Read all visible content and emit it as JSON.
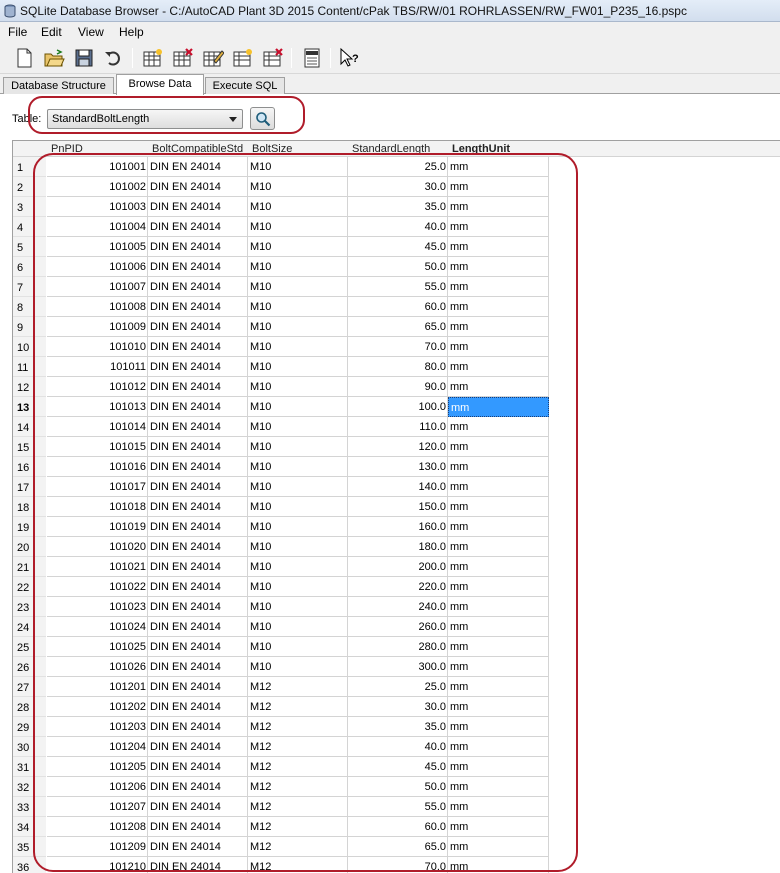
{
  "window": {
    "title": "SQLite Database Browser - C:/AutoCAD Plant 3D 2015 Content/cPak TBS/RW/01 ROHRLASSEN/RW_FW01_P235_16.pspc"
  },
  "menu": [
    "File",
    "Edit",
    "View",
    "Help"
  ],
  "toolbar": {
    "icons": [
      "new-database-icon",
      "open-database-icon",
      "save-icon",
      "undo-icon",
      "create-table-icon",
      "delete-table-icon",
      "modify-table-icon",
      "create-index-icon",
      "delete-index-icon",
      "sql-log-icon",
      "whats-this-help-icon"
    ]
  },
  "tabs": [
    "Database Structure",
    "Browse Data",
    "Execute SQL"
  ],
  "active_tab": "Browse Data",
  "browse": {
    "table_label": "Table:",
    "table_value": "StandardBoltLength"
  },
  "grid": {
    "columns": [
      "PnPID",
      "BoltCompatibleStd",
      "BoltSize",
      "StandardLength",
      "LengthUnit"
    ],
    "selected_row": 13,
    "rows": [
      [
        "1",
        "101001",
        "DIN EN 24014",
        "M10",
        "25.0",
        "mm"
      ],
      [
        "2",
        "101002",
        "DIN EN 24014",
        "M10",
        "30.0",
        "mm"
      ],
      [
        "3",
        "101003",
        "DIN EN 24014",
        "M10",
        "35.0",
        "mm"
      ],
      [
        "4",
        "101004",
        "DIN EN 24014",
        "M10",
        "40.0",
        "mm"
      ],
      [
        "5",
        "101005",
        "DIN EN 24014",
        "M10",
        "45.0",
        "mm"
      ],
      [
        "6",
        "101006",
        "DIN EN 24014",
        "M10",
        "50.0",
        "mm"
      ],
      [
        "7",
        "101007",
        "DIN EN 24014",
        "M10",
        "55.0",
        "mm"
      ],
      [
        "8",
        "101008",
        "DIN EN 24014",
        "M10",
        "60.0",
        "mm"
      ],
      [
        "9",
        "101009",
        "DIN EN 24014",
        "M10",
        "65.0",
        "mm"
      ],
      [
        "10",
        "101010",
        "DIN EN 24014",
        "M10",
        "70.0",
        "mm"
      ],
      [
        "11",
        "101011",
        "DIN EN 24014",
        "M10",
        "80.0",
        "mm"
      ],
      [
        "12",
        "101012",
        "DIN EN 24014",
        "M10",
        "90.0",
        "mm"
      ],
      [
        "13",
        "101013",
        "DIN EN 24014",
        "M10",
        "100.0",
        "mm"
      ],
      [
        "14",
        "101014",
        "DIN EN 24014",
        "M10",
        "110.0",
        "mm"
      ],
      [
        "15",
        "101015",
        "DIN EN 24014",
        "M10",
        "120.0",
        "mm"
      ],
      [
        "16",
        "101016",
        "DIN EN 24014",
        "M10",
        "130.0",
        "mm"
      ],
      [
        "17",
        "101017",
        "DIN EN 24014",
        "M10",
        "140.0",
        "mm"
      ],
      [
        "18",
        "101018",
        "DIN EN 24014",
        "M10",
        "150.0",
        "mm"
      ],
      [
        "19",
        "101019",
        "DIN EN 24014",
        "M10",
        "160.0",
        "mm"
      ],
      [
        "20",
        "101020",
        "DIN EN 24014",
        "M10",
        "180.0",
        "mm"
      ],
      [
        "21",
        "101021",
        "DIN EN 24014",
        "M10",
        "200.0",
        "mm"
      ],
      [
        "22",
        "101022",
        "DIN EN 24014",
        "M10",
        "220.0",
        "mm"
      ],
      [
        "23",
        "101023",
        "DIN EN 24014",
        "M10",
        "240.0",
        "mm"
      ],
      [
        "24",
        "101024",
        "DIN EN 24014",
        "M10",
        "260.0",
        "mm"
      ],
      [
        "25",
        "101025",
        "DIN EN 24014",
        "M10",
        "280.0",
        "mm"
      ],
      [
        "26",
        "101026",
        "DIN EN 24014",
        "M10",
        "300.0",
        "mm"
      ],
      [
        "27",
        "101201",
        "DIN EN 24014",
        "M12",
        "25.0",
        "mm"
      ],
      [
        "28",
        "101202",
        "DIN EN 24014",
        "M12",
        "30.0",
        "mm"
      ],
      [
        "29",
        "101203",
        "DIN EN 24014",
        "M12",
        "35.0",
        "mm"
      ],
      [
        "30",
        "101204",
        "DIN EN 24014",
        "M12",
        "40.0",
        "mm"
      ],
      [
        "31",
        "101205",
        "DIN EN 24014",
        "M12",
        "45.0",
        "mm"
      ],
      [
        "32",
        "101206",
        "DIN EN 24014",
        "M12",
        "50.0",
        "mm"
      ],
      [
        "33",
        "101207",
        "DIN EN 24014",
        "M12",
        "55.0",
        "mm"
      ],
      [
        "34",
        "101208",
        "DIN EN 24014",
        "M12",
        "60.0",
        "mm"
      ],
      [
        "35",
        "101209",
        "DIN EN 24014",
        "M12",
        "65.0",
        "mm"
      ],
      [
        "36",
        "101210",
        "DIN EN 24014",
        "M12",
        "70.0",
        "mm"
      ]
    ]
  },
  "colors": {
    "highlight_ring": "#b01c2a",
    "selection": "#3399ff"
  }
}
